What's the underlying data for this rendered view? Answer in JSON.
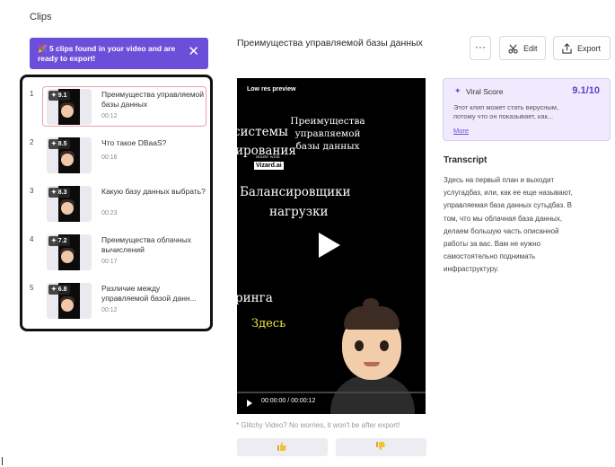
{
  "header": {
    "section_title": "Clips"
  },
  "banner": {
    "icon": "party-popper-icon",
    "text": "🎉 5 clips found in your video and are ready to export!",
    "close": "✕"
  },
  "clips": [
    {
      "number": "1",
      "score": "✦ 9.1",
      "title": "Преимущества управляемой базы данных",
      "duration": "00:12"
    },
    {
      "number": "2",
      "score": "✦ 8.5",
      "title": "Что такое DBaaS?",
      "duration": "00:16"
    },
    {
      "number": "3",
      "score": "✦ 8.3",
      "title": "Какую базу данных выбрать?",
      "duration": "00:23"
    },
    {
      "number": "4",
      "score": "✦ 7.2",
      "title": "Преимущества облачных вычислений",
      "duration": "00:17"
    },
    {
      "number": "5",
      "score": "✦ 6.8",
      "title": "Различие между управляемой базой данн...",
      "duration": "00:12"
    }
  ],
  "video": {
    "title": "Преимущества управляемой базы данных",
    "lowres": "Low res preview",
    "captions": {
      "line1": "Преимущества управляемой\nбазы данных",
      "line2": "системы",
      "line3": "ирования",
      "made_with": "made with",
      "logo": "Vizard.ai",
      "line5": "Балансировщики",
      "line6": "нагрузки",
      "line7": "ринга",
      "line8": "Здесь"
    },
    "timecode": "00:00:00 / 00:00:12",
    "progress": 0,
    "glitch_note": "* Glitchy Video? No worries, it won't be after export!"
  },
  "toolbar": {
    "more": "···",
    "edit": "Edit",
    "export": "Export"
  },
  "viral": {
    "label": "Viral Score",
    "score": "9.1/10",
    "text": "Этот клип может стать вирусным,\nпотому что он показывает, как...",
    "more": "More"
  },
  "transcript": {
    "title": "Transcript",
    "text": "Здесь на первый план и выходит\nуслугадбаз, или, как ее еще называют,\nуправляемая база данных сутьдбаз. В\nтом, что мы облачная база данных,\nделаем большую часть описанной\nработы за вас. Вам не нужно\nсамостоятельно поднимать\nинфраструктуру."
  },
  "colors": {
    "accent": "#6c4fd8",
    "selected_border": "#e8a2ad",
    "viral_bg": "#efeafd"
  }
}
